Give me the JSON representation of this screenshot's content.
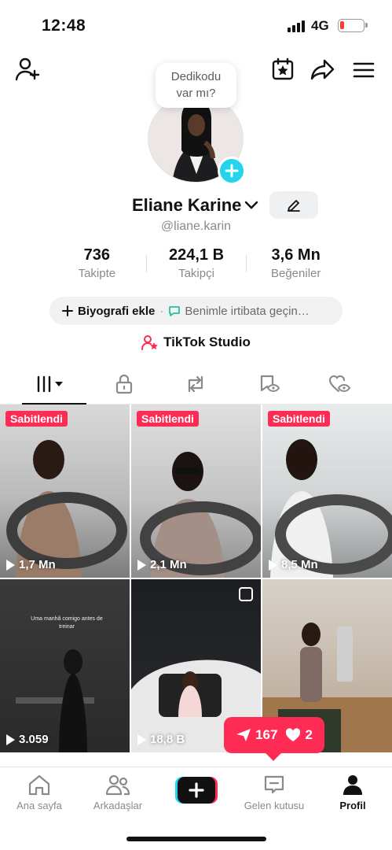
{
  "status_bar": {
    "time": "12:48",
    "network": "4G"
  },
  "profile": {
    "bubble_line1": "Dedikodu",
    "bubble_line2": "var mı?",
    "name": "Eliane Karine",
    "handle": "@liane.karin",
    "stats": [
      {
        "value": "736",
        "label": "Takipte"
      },
      {
        "value": "224,1 B",
        "label": "Takipçi"
      },
      {
        "value": "3,6 Mn",
        "label": "Beğeniler"
      }
    ],
    "bio_add": "Biyografi ekle",
    "contact": "Benimle irtibata geçin…",
    "studio": "TikTok Studio"
  },
  "videos": [
    {
      "pinned": "Sabitlendi",
      "views": "1,7 Mn"
    },
    {
      "pinned": "Sabitlendi",
      "views": "2,1 Mn"
    },
    {
      "pinned": "Sabitlendi",
      "views": "8,5 Mn"
    },
    {
      "views": "3.059",
      "caption": "Uma manhã comigo antes de treinar"
    },
    {
      "views": "18,8 B"
    },
    {
      "views": ""
    }
  ],
  "notification": {
    "shares": "167",
    "likes": "2"
  },
  "bottom_nav": [
    {
      "label": "Ana sayfa",
      "icon": "home-icon"
    },
    {
      "label": "Arkadaşlar",
      "icon": "friends-icon"
    },
    {
      "label": "",
      "icon": "create-icon"
    },
    {
      "label": "Gelen kutusu",
      "icon": "inbox-icon"
    },
    {
      "label": "Profil",
      "icon": "profile-icon"
    }
  ],
  "colors": {
    "accent": "#fe2c55",
    "cyan": "#20d5ec",
    "studio_icon": "#fe2c55"
  }
}
